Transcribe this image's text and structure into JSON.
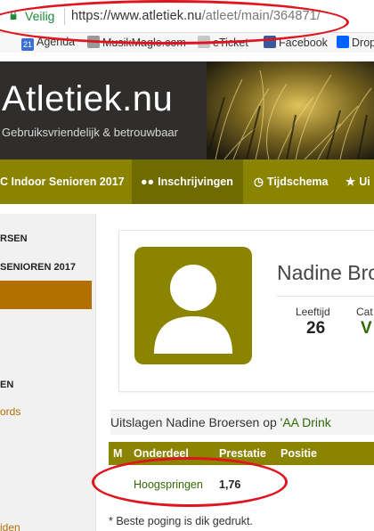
{
  "browser": {
    "secure_label": "Veilig",
    "url_host": "https://www.atletiek.nu",
    "url_path": "/atleet/main/364871/",
    "bookmarks": [
      "Agenda",
      "MusikMagle.com",
      "eTicket",
      "Facebook",
      "Drop"
    ],
    "bookmark_calendar_day": "21"
  },
  "site": {
    "logo": "Atletiek.nu",
    "tagline": "Gebruiksvriendelijk & betrouwbaar"
  },
  "nav": {
    "items": [
      {
        "label": "C Indoor Senioren 2017",
        "icon": "trophy-icon"
      },
      {
        "label": "Inschrijvingen",
        "icon": "users-icon"
      },
      {
        "label": "Tijdschema",
        "icon": "clock-icon"
      },
      {
        "label": "Ui",
        "icon": "trophy-icon"
      }
    ]
  },
  "sidebar": {
    "items": [
      "RSEN",
      "SENIOREN 2017",
      "EN",
      "ords"
    ]
  },
  "profile": {
    "name": "Nadine Broe",
    "stats": [
      {
        "label": "Leeftijd",
        "value": "26"
      },
      {
        "label": "Cat",
        "value": "V"
      }
    ]
  },
  "results": {
    "title_prefix": "Uitslagen Nadine Broersen op ",
    "title_link": "'AA Drink",
    "columns": [
      "M",
      "Onderdeel",
      "Prestatie",
      "Positie"
    ],
    "rows": [
      {
        "event": "Hoogspringen",
        "performance": "1,76",
        "position": ""
      }
    ],
    "footnote": "* Beste poging is dik gedrukt.",
    "sidebar_bottom": "iden"
  },
  "colors": {
    "olive": "#8a8400",
    "annotation_red": "#e0141e",
    "sidebar_active": "#b36f00"
  }
}
